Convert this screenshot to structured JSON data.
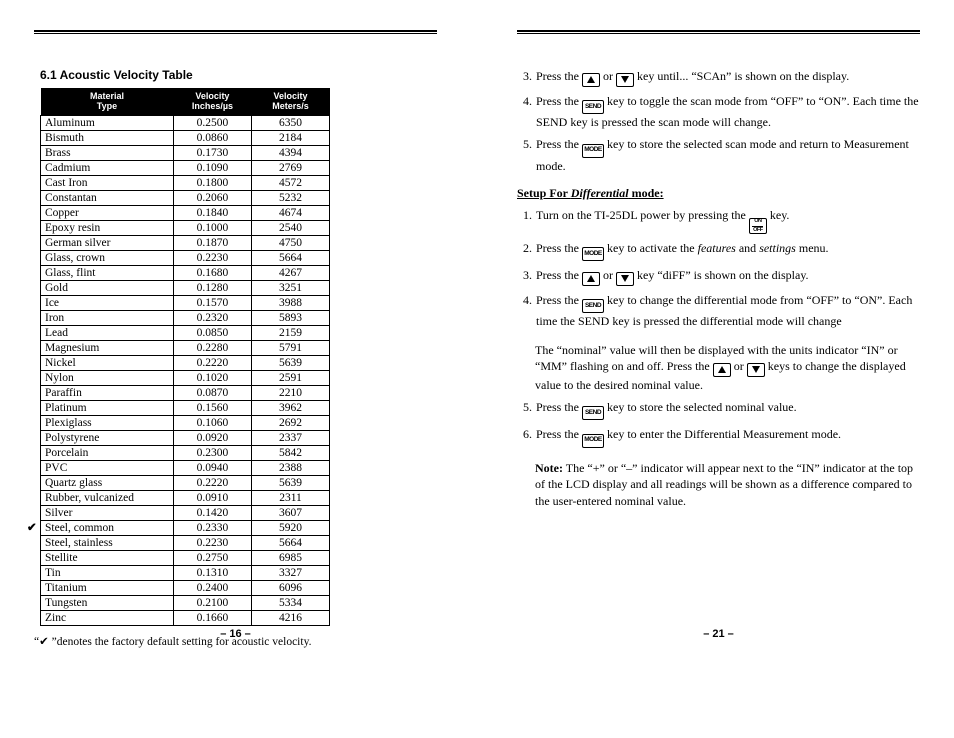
{
  "left": {
    "title": "6.1 Acoustic Velocity Table",
    "headers": {
      "mat1": "Material",
      "mat2": "Type",
      "v1a": "Velocity",
      "v1b": "Inches/µs",
      "v2a": "Velocity",
      "v2b": "Meters/s"
    },
    "default_row_index": 27,
    "rows": [
      {
        "m": "Aluminum",
        "in": "0.2500",
        "ms": "6350"
      },
      {
        "m": "Bismuth",
        "in": "0.0860",
        "ms": "2184"
      },
      {
        "m": "Brass",
        "in": "0.1730",
        "ms": "4394"
      },
      {
        "m": "Cadmium",
        "in": "0.1090",
        "ms": "2769"
      },
      {
        "m": "Cast Iron",
        "in": "0.1800",
        "ms": "4572"
      },
      {
        "m": "Constantan",
        "in": "0.2060",
        "ms": "5232"
      },
      {
        "m": "Copper",
        "in": "0.1840",
        "ms": "4674"
      },
      {
        "m": "Epoxy resin",
        "in": "0.1000",
        "ms": "2540"
      },
      {
        "m": "German silver",
        "in": "0.1870",
        "ms": "4750"
      },
      {
        "m": "Glass, crown",
        "in": "0.2230",
        "ms": "5664"
      },
      {
        "m": "Glass, flint",
        "in": "0.1680",
        "ms": "4267"
      },
      {
        "m": "Gold",
        "in": "0.1280",
        "ms": "3251"
      },
      {
        "m": "Ice",
        "in": "0.1570",
        "ms": "3988"
      },
      {
        "m": "Iron",
        "in": "0.2320",
        "ms": "5893"
      },
      {
        "m": "Lead",
        "in": "0.0850",
        "ms": "2159"
      },
      {
        "m": "Magnesium",
        "in": "0.2280",
        "ms": "5791"
      },
      {
        "m": "Nickel",
        "in": "0.2220",
        "ms": "5639"
      },
      {
        "m": "Nylon",
        "in": "0.1020",
        "ms": "2591"
      },
      {
        "m": "Paraffin",
        "in": "0.0870",
        "ms": "2210"
      },
      {
        "m": "Platinum",
        "in": "0.1560",
        "ms": "3962"
      },
      {
        "m": "Plexiglass",
        "in": "0.1060",
        "ms": "2692"
      },
      {
        "m": "Polystyrene",
        "in": "0.0920",
        "ms": "2337"
      },
      {
        "m": "Porcelain",
        "in": "0.2300",
        "ms": "5842"
      },
      {
        "m": "PVC",
        "in": "0.0940",
        "ms": "2388"
      },
      {
        "m": "Quartz glass",
        "in": "0.2220",
        "ms": "5639"
      },
      {
        "m": "Rubber, vulcanized",
        "in": "0.0910",
        "ms": "2311"
      },
      {
        "m": "Silver",
        "in": "0.1420",
        "ms": "3607"
      },
      {
        "m": "Steel, common",
        "in": "0.2330",
        "ms": "5920"
      },
      {
        "m": "Steel, stainless",
        "in": "0.2230",
        "ms": "5664"
      },
      {
        "m": "Stellite",
        "in": "0.2750",
        "ms": "6985"
      },
      {
        "m": "Tin",
        "in": "0.1310",
        "ms": "3327"
      },
      {
        "m": "Titanium",
        "in": "0.2400",
        "ms": "6096"
      },
      {
        "m": "Tungsten",
        "in": "0.2100",
        "ms": "5334"
      },
      {
        "m": "Zinc",
        "in": "0.1660",
        "ms": "4216"
      }
    ],
    "footnote_pre": "“",
    "footnote_check": "✔",
    "footnote_post": " ”denotes the factory default setting for acoustic velocity.",
    "page": "– 16 –"
  },
  "right": {
    "topStart": 3,
    "top": [
      {
        "pre": "Press the ",
        "k1": "up",
        "mid": " or ",
        "k2": "down",
        "post": " key until... “SCAn” is shown on the display."
      },
      {
        "pre": "Press the ",
        "k1": "SEND",
        "post": " key to toggle the scan mode from “OFF” to “ON”. Each time the SEND key is pressed the scan mode will change."
      },
      {
        "pre": "Press the ",
        "k1": "MODE",
        "post": " key to store the selected scan mode and return to Measurement mode."
      }
    ],
    "subhead_a": "Setup For ",
    "subhead_em": "Differential",
    "subhead_b": " mode:",
    "diff": [
      {
        "pre": "Turn on the TI-25DL power by pressing the ",
        "k1": "ONOFF",
        "post": " key."
      },
      {
        "pre": "Press the ",
        "k1": "MODE",
        "post_a": " key to activate the ",
        "em": "features",
        "post_b": " and ",
        "em2": "settings",
        "post_c": " menu."
      },
      {
        "pre": "Press the ",
        "k1": "up",
        "mid": " or ",
        "k2": "down",
        "post": " key “diFF” is shown on the display."
      },
      {
        "pre": "Press the ",
        "k1": "SEND",
        "post": " key to change the differential mode from “OFF” to “ON”. Each time the SEND key is pressed the differential mode will change"
      }
    ],
    "nominal_a": "The “nominal” value will then be displayed with the units indicator “IN” or “MM” flashing on and off. Press the ",
    "nominal_mid": " or ",
    "nominal_b": " keys to change the displayed value to the desired nominal value.",
    "diff2Start": 5,
    "diff2": [
      {
        "pre": "Press the ",
        "k1": "SEND",
        "post": " key to store the selected nominal value."
      },
      {
        "pre": "Press the ",
        "k1": "MODE",
        "post": " key to enter the Differential Measurement mode."
      }
    ],
    "note_label": "Note:",
    "note_body": " The “+” or “–” indicator will appear next to the “IN” indicator at the top of the LCD display and all readings will be shown as a difference compared to the user-entered nominal value.",
    "page": "– 21 –"
  },
  "chart_data": {
    "type": "table",
    "title": "6.1 Acoustic Velocity Table",
    "columns": [
      "Material Type",
      "Velocity Inches/µs",
      "Velocity Meters/s"
    ],
    "rows": [
      [
        "Aluminum",
        "0.2500",
        "6350"
      ],
      [
        "Bismuth",
        "0.0860",
        "2184"
      ],
      [
        "Brass",
        "0.1730",
        "4394"
      ],
      [
        "Cadmium",
        "0.1090",
        "2769"
      ],
      [
        "Cast Iron",
        "0.1800",
        "4572"
      ],
      [
        "Constantan",
        "0.2060",
        "5232"
      ],
      [
        "Copper",
        "0.1840",
        "4674"
      ],
      [
        "Epoxy resin",
        "0.1000",
        "2540"
      ],
      [
        "German silver",
        "0.1870",
        "4750"
      ],
      [
        "Glass, crown",
        "0.2230",
        "5664"
      ],
      [
        "Glass, flint",
        "0.1680",
        "4267"
      ],
      [
        "Gold",
        "0.1280",
        "3251"
      ],
      [
        "Ice",
        "0.1570",
        "3988"
      ],
      [
        "Iron",
        "0.2320",
        "5893"
      ],
      [
        "Lead",
        "0.0850",
        "2159"
      ],
      [
        "Magnesium",
        "0.2280",
        "5791"
      ],
      [
        "Nickel",
        "0.2220",
        "5639"
      ],
      [
        "Nylon",
        "0.1020",
        "2591"
      ],
      [
        "Paraffin",
        "0.0870",
        "2210"
      ],
      [
        "Platinum",
        "0.1560",
        "3962"
      ],
      [
        "Plexiglass",
        "0.1060",
        "2692"
      ],
      [
        "Polystyrene",
        "0.0920",
        "2337"
      ],
      [
        "Porcelain",
        "0.2300",
        "5842"
      ],
      [
        "PVC",
        "0.0940",
        "2388"
      ],
      [
        "Quartz glass",
        "0.2220",
        "5639"
      ],
      [
        "Rubber, vulcanized",
        "0.0910",
        "2311"
      ],
      [
        "Silver",
        "0.1420",
        "3607"
      ],
      [
        "Steel, common",
        "0.2330",
        "5920"
      ],
      [
        "Steel, stainless",
        "0.2230",
        "5664"
      ],
      [
        "Stellite",
        "0.2750",
        "6985"
      ],
      [
        "Tin",
        "0.1310",
        "3327"
      ],
      [
        "Titanium",
        "0.2400",
        "6096"
      ],
      [
        "Tungsten",
        "0.2100",
        "5334"
      ],
      [
        "Zinc",
        "0.1660",
        "4216"
      ]
    ],
    "default_row": "Steel, common"
  }
}
